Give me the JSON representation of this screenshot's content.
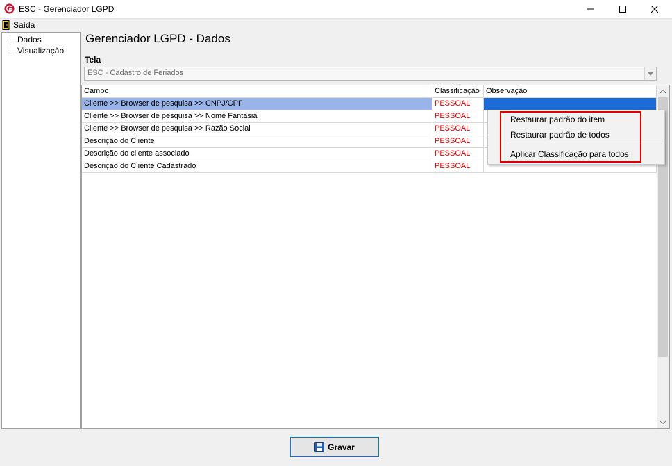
{
  "window": {
    "title": "ESC - Gerenciador LGPD"
  },
  "menu": {
    "exit_label": "Saída"
  },
  "tree": {
    "items": [
      {
        "label": "Dados"
      },
      {
        "label": "Visualização"
      }
    ]
  },
  "page": {
    "title": "Gerenciador LGPD - Dados",
    "tela_label": "Tela",
    "tela_value": "ESC - Cadastro de Feriados"
  },
  "grid": {
    "columns": [
      "Campo",
      "Classificação",
      "Observação"
    ],
    "rows": [
      {
        "campo": "Cliente >> Browser de pesquisa >> CNPJ/CPF",
        "classificacao": "PESSOAL",
        "observacao": "",
        "selected": true
      },
      {
        "campo": "Cliente >> Browser de pesquisa >> Nome Fantasia",
        "classificacao": "PESSOAL",
        "observacao": ""
      },
      {
        "campo": "Cliente >> Browser de pesquisa >> Razão Social",
        "classificacao": "PESSOAL",
        "observacao": ""
      },
      {
        "campo": "Descrição do Cliente",
        "classificacao": "PESSOAL",
        "observacao": ""
      },
      {
        "campo": "Descrição do cliente associado",
        "classificacao": "PESSOAL",
        "observacao": ""
      },
      {
        "campo": "Descrição do Cliente Cadastrado",
        "classificacao": "PESSOAL",
        "observacao": ""
      }
    ]
  },
  "context_menu": {
    "items": [
      {
        "label": "Restaurar padrão do item"
      },
      {
        "label": "Restaurar padrão de todos"
      },
      {
        "label": "Aplicar Classificação para todos"
      }
    ]
  },
  "footer": {
    "save_label": "Gravar"
  },
  "colors": {
    "selection_row": "#99b4e8",
    "selection_cell": "#1c6bd6",
    "classification_text": "#e00000",
    "highlight_box": "#e00000"
  },
  "icons": {
    "app": "app-logo-icon",
    "exit": "exit-door-icon",
    "save": "floppy-disk-icon"
  }
}
